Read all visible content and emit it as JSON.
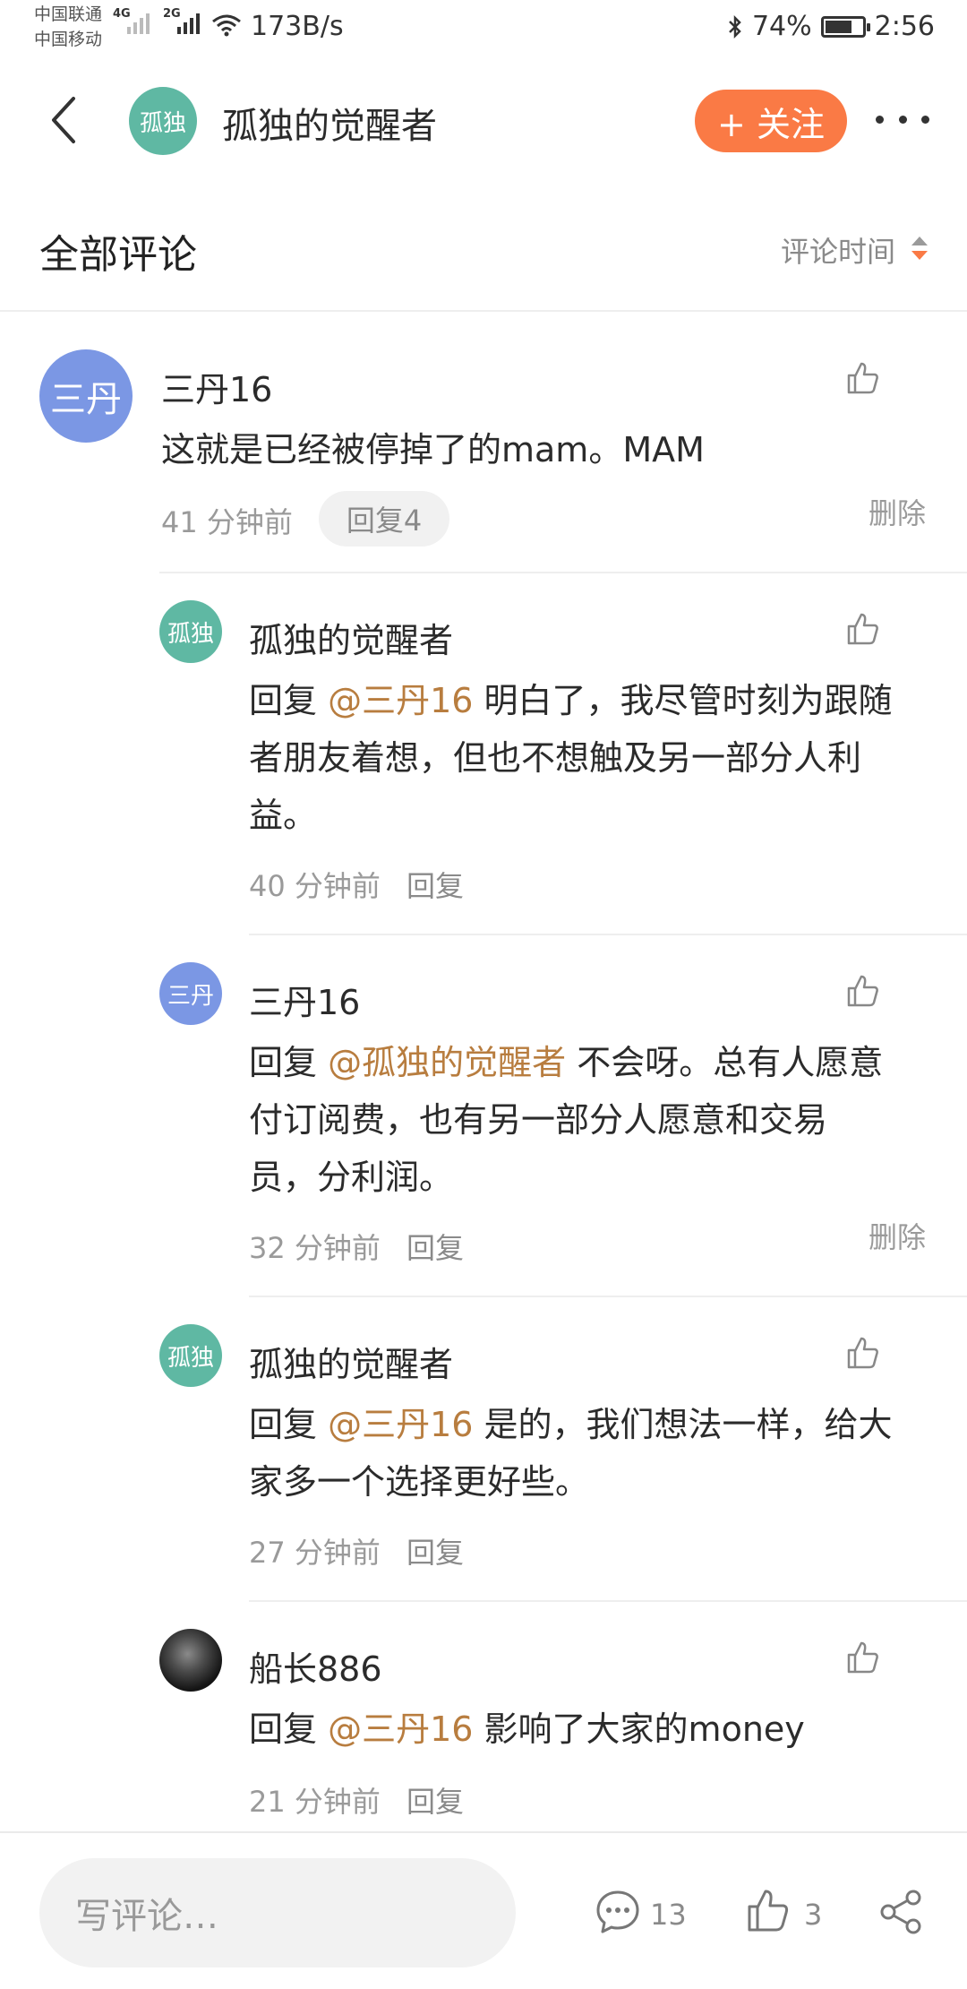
{
  "status_bar": {
    "carrier_1": "中国联通",
    "carrier_2": "中国移动",
    "net_1": "4G",
    "net_2": "2G",
    "speed": "173B/s",
    "battery": "74%",
    "battery_level": 0.74,
    "time": "2:56"
  },
  "header": {
    "avatar_text": "孤独",
    "title": "孤独的觉醒者",
    "follow_label": "+ 关注"
  },
  "comments_section": {
    "title": "全部评论",
    "sort_label": "评论时间"
  },
  "main_comment": {
    "avatar_text": "三丹",
    "author": "三丹16",
    "text": "这就是已经被停掉了的mam。MAM",
    "time": "41 分钟前",
    "reply_pill": "回复4",
    "delete_label": "删除"
  },
  "replies": [
    {
      "avatar_text": "孤独",
      "author": "孤独的觉醒者",
      "prefix": "回复",
      "mention": "@三丹16",
      "line1": " 明白了，我尽管时刻为跟随",
      "line2": "者朋友着想，但也不想触及另一部分人利",
      "line3": "益。",
      "time": "40 分钟前",
      "reply_label": "回复"
    },
    {
      "avatar_text": "三丹",
      "author": "三丹16",
      "prefix": "回复",
      "mention": "@孤独的觉醒者",
      "line1": " 不会呀。总有人愿意",
      "line2": "付订阅费，也有另一部分人愿意和交易",
      "line3": "员，分利润。",
      "time": "32 分钟前",
      "reply_label": "回复",
      "delete_label": "删除"
    },
    {
      "avatar_text": "孤独",
      "author": "孤独的觉醒者",
      "prefix": "回复",
      "mention": "@三丹16",
      "line1": " 是的，我们想法一样，给大",
      "line2": "家多一个选择更好些。",
      "time": "27 分钟前",
      "reply_label": "回复"
    },
    {
      "author": "船长886",
      "prefix": "回复",
      "mention": "@三丹16",
      "line1": " 影响了大家的money",
      "time": "21 分钟前",
      "reply_label": "回复"
    }
  ],
  "bottom_bar": {
    "input_placeholder": "写评论…",
    "comment_count": "13",
    "like_count": "3"
  },
  "icons": {
    "back": "back-arrow-icon",
    "more": "more-dots-icon",
    "sort": "sort-arrows-icon",
    "like": "thumbs-up-icon",
    "comment": "comment-bubble-icon",
    "share": "share-icon"
  },
  "colors": {
    "accent": "#fa7a45",
    "mention": "#b87d3f",
    "avatar_blue": "#7b97e4",
    "avatar_green": "#5fb8a3"
  }
}
